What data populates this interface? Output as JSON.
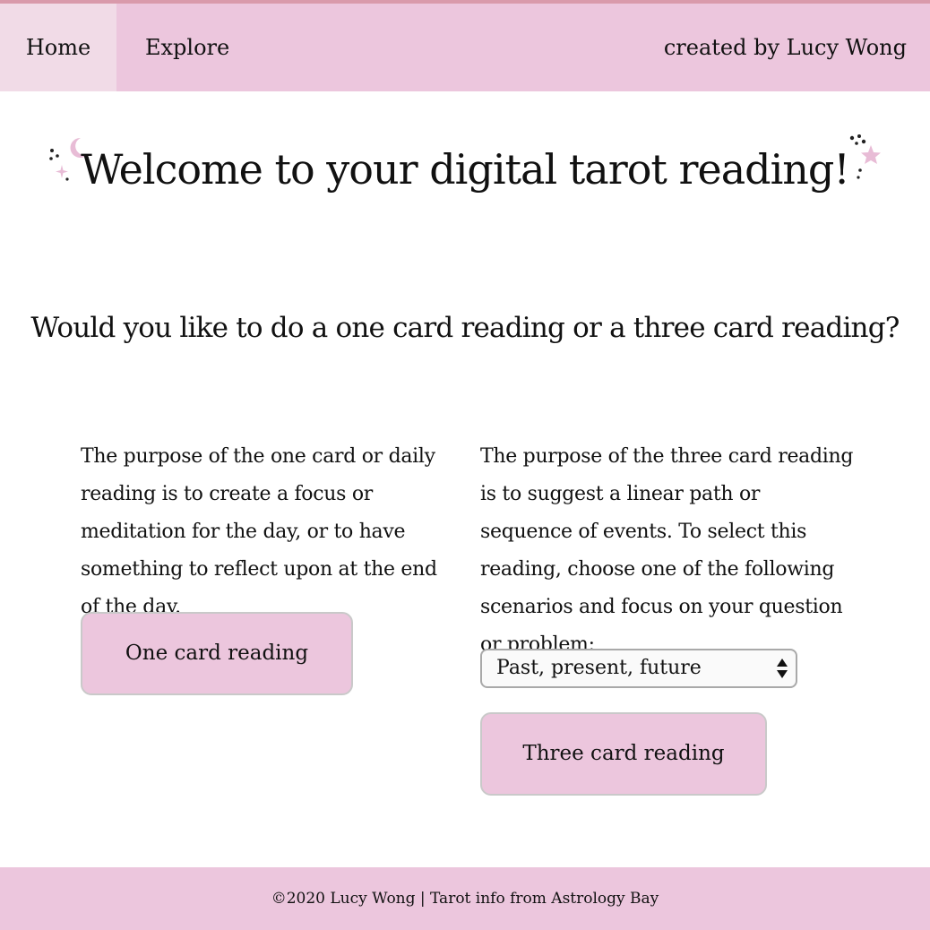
{
  "nav": {
    "home": "Home",
    "explore": "Explore",
    "credit": "created by Lucy Wong"
  },
  "main": {
    "title": "Welcome to your digital tarot reading!",
    "question": "Would you like to do a one card reading or a three card reading?",
    "one_card": {
      "description": "The purpose of the one card or daily reading is to create a focus or meditation for the day, or to have something to reflect upon at the end of the day.",
      "button": "One card reading"
    },
    "three_card": {
      "description": "The purpose of the three card reading is to suggest a linear path or sequence of events. To select this reading, choose one of the following scenarios and focus on your question or problem:",
      "select_value": "Past, present, future",
      "button": "Three card reading"
    }
  },
  "footer": {
    "copyright": "©2020 Lucy Wong | Tarot info from ",
    "link": "Astrology Bay"
  },
  "colors": {
    "nav_bg": "#ecc6dd",
    "nav_active": "#f1dbe7",
    "button_bg": "#ecc6dd",
    "accent_line": "#d99aab"
  },
  "icons": [
    "moon-sparkles-icon",
    "stars-sparkles-icon",
    "select-arrows-icon"
  ]
}
